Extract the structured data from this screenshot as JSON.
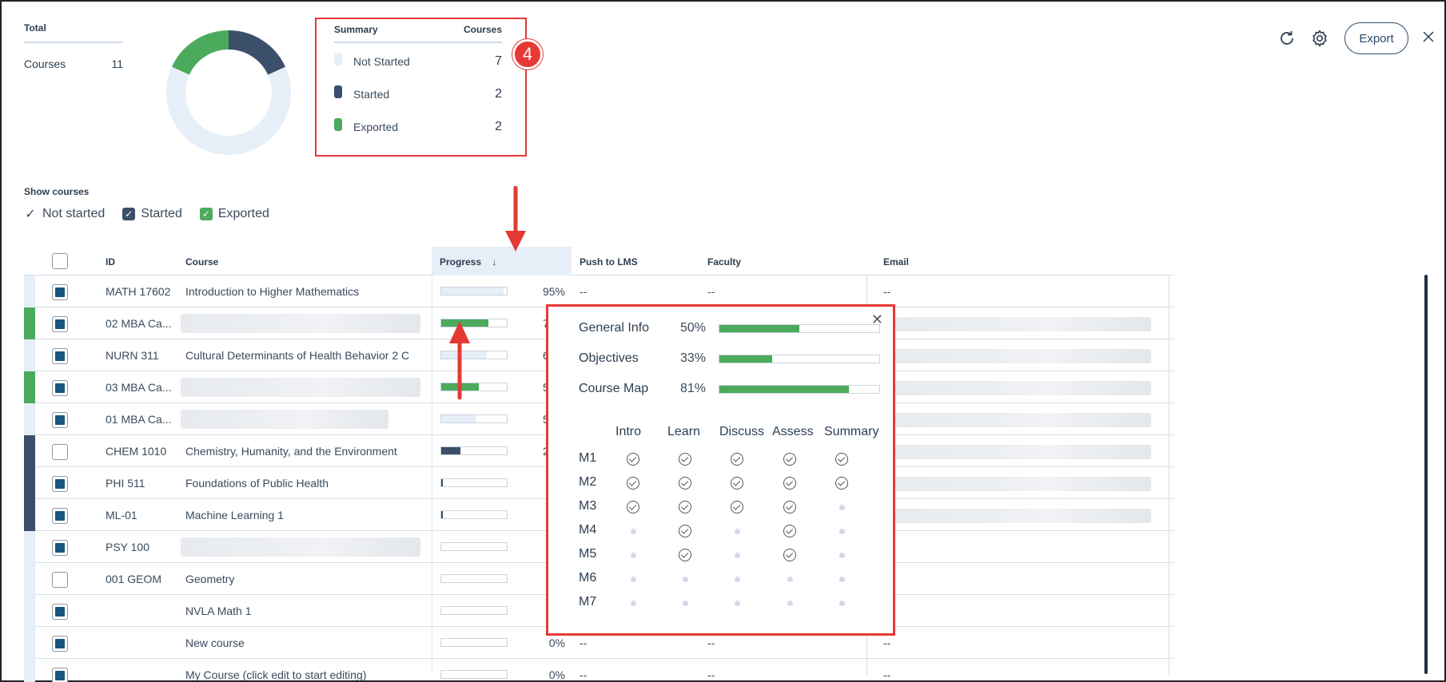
{
  "total": {
    "title": "Total",
    "label": "Courses",
    "value": "11"
  },
  "summary": {
    "header_left": "Summary",
    "header_right": "Courses",
    "rows": [
      {
        "label": "Not Started",
        "value": "7",
        "color": "#e6eef8"
      },
      {
        "label": "Started",
        "value": "2",
        "color": "#3b4f6b"
      },
      {
        "label": "Exported",
        "value": "2",
        "color": "#4caa5c"
      }
    ],
    "badge": "4"
  },
  "donut": {
    "not_started": 7,
    "started": 2,
    "exported": 2
  },
  "toolbar": {
    "export_label": "Export"
  },
  "filters": {
    "title": "Show courses",
    "items": [
      {
        "label": "Not started"
      },
      {
        "label": "Started"
      },
      {
        "label": "Exported"
      }
    ]
  },
  "table": {
    "headers": {
      "id": "ID",
      "course": "Course",
      "progress": "Progress",
      "push": "Push to LMS",
      "faculty": "Faculty",
      "email": "Email"
    },
    "rows": [
      {
        "id": "MATH 17602",
        "course": "Introduction to Higher Mathematics",
        "progress": 95,
        "pct": "95%",
        "push": "--",
        "faculty": "--",
        "email": "--",
        "status": "#e6eef8",
        "checked": true,
        "bar": "#e6eef8"
      },
      {
        "id": "02 MBA Ca...",
        "course": "",
        "progress": 72,
        "pct": "72%",
        "push": "",
        "faculty": "",
        "email": "",
        "status": "#4caa5c",
        "checked": true,
        "bar": "#4caa5c"
      },
      {
        "id": "NURN 311",
        "course": "Cultural Determinants of Health Behavior 2 C",
        "progress": 69,
        "pct": "69%",
        "push": "",
        "faculty": "",
        "email": "",
        "status": "#e6eef8",
        "checked": true,
        "bar": "#e6eef8"
      },
      {
        "id": "03 MBA Ca...",
        "course": "",
        "progress": 57,
        "pct": "57%",
        "push": "",
        "faculty": "",
        "email": "",
        "status": "#4caa5c",
        "checked": true,
        "bar": "#4caa5c"
      },
      {
        "id": "01 MBA Ca...",
        "course": "",
        "progress": 52,
        "pct": "52%",
        "push": "",
        "faculty": "",
        "email": "",
        "status": "#e6eef8",
        "checked": true,
        "bar": "#e6eef8"
      },
      {
        "id": "CHEM 1010",
        "course": "Chemistry, Humanity, and the Environment",
        "progress": 29,
        "pct": "29%",
        "push": "",
        "faculty": "",
        "email": "",
        "status": "#3b4f6b",
        "checked": false,
        "bar": "#3b4f6b"
      },
      {
        "id": "PHI 511",
        "course": "Foundations of Public Health",
        "progress": 2,
        "pct": "2%",
        "push": "",
        "faculty": "",
        "email": "",
        "status": "#3b4f6b",
        "checked": true,
        "bar": "#3b4f6b"
      },
      {
        "id": "ML-01",
        "course": "Machine Learning 1",
        "progress": 2,
        "pct": "2%",
        "push": "",
        "faculty": "",
        "email": "",
        "status": "#3b4f6b",
        "checked": true,
        "bar": "#3b4f6b"
      },
      {
        "id": "PSY 100",
        "course": "",
        "progress": 0,
        "pct": "0%",
        "push": "",
        "faculty": "",
        "email": "",
        "status": "#e6eef8",
        "checked": true,
        "bar": "#e6eef8"
      },
      {
        "id": "001 GEOM",
        "course": "Geometry",
        "progress": 0,
        "pct": "0%",
        "push": "",
        "faculty": "",
        "email": "",
        "status": "#e6eef8",
        "checked": false,
        "bar": "#e6eef8"
      },
      {
        "id": "",
        "course": "NVLA Math 1",
        "progress": 0,
        "pct": "0%",
        "push": "",
        "faculty": "",
        "email": "",
        "status": "#e6eef8",
        "checked": true,
        "bar": "#e6eef8"
      },
      {
        "id": "",
        "course": "New course",
        "progress": 0,
        "pct": "0%",
        "push": "--",
        "faculty": "--",
        "email": "--",
        "status": "#e6eef8",
        "checked": true,
        "bar": "#e6eef8"
      },
      {
        "id": "",
        "course": "My Course (click edit to start editing)",
        "progress": 0,
        "pct": "0%",
        "push": "--",
        "faculty": "--",
        "email": "--",
        "status": "#e6eef8",
        "checked": true,
        "bar": "#e6eef8"
      }
    ]
  },
  "popup": {
    "bars": [
      {
        "label": "General Info",
        "pct": "50%",
        "value": 50
      },
      {
        "label": "Objectives",
        "pct": "33%",
        "value": 33
      },
      {
        "label": "Course Map",
        "pct": "81%",
        "value": 81
      }
    ],
    "columns": [
      "Intro",
      "Learn",
      "Discuss",
      "Assess",
      "Summary"
    ],
    "modules": [
      {
        "label": "M1",
        "done": [
          true,
          true,
          true,
          true,
          true
        ]
      },
      {
        "label": "M2",
        "done": [
          true,
          true,
          true,
          true,
          true
        ]
      },
      {
        "label": "M3",
        "done": [
          true,
          true,
          true,
          true,
          false
        ]
      },
      {
        "label": "M4",
        "done": [
          false,
          true,
          false,
          true,
          false
        ]
      },
      {
        "label": "M5",
        "done": [
          false,
          true,
          false,
          true,
          false
        ]
      },
      {
        "label": "M6",
        "done": [
          false,
          false,
          false,
          false,
          false
        ]
      },
      {
        "label": "M7",
        "done": [
          false,
          false,
          false,
          false,
          false
        ]
      }
    ]
  },
  "colors": {
    "accent_red": "#e53935",
    "navy": "#3b4f6b",
    "green": "#4caa5c",
    "light": "#e6eef8",
    "checkbox": "#19557e"
  }
}
